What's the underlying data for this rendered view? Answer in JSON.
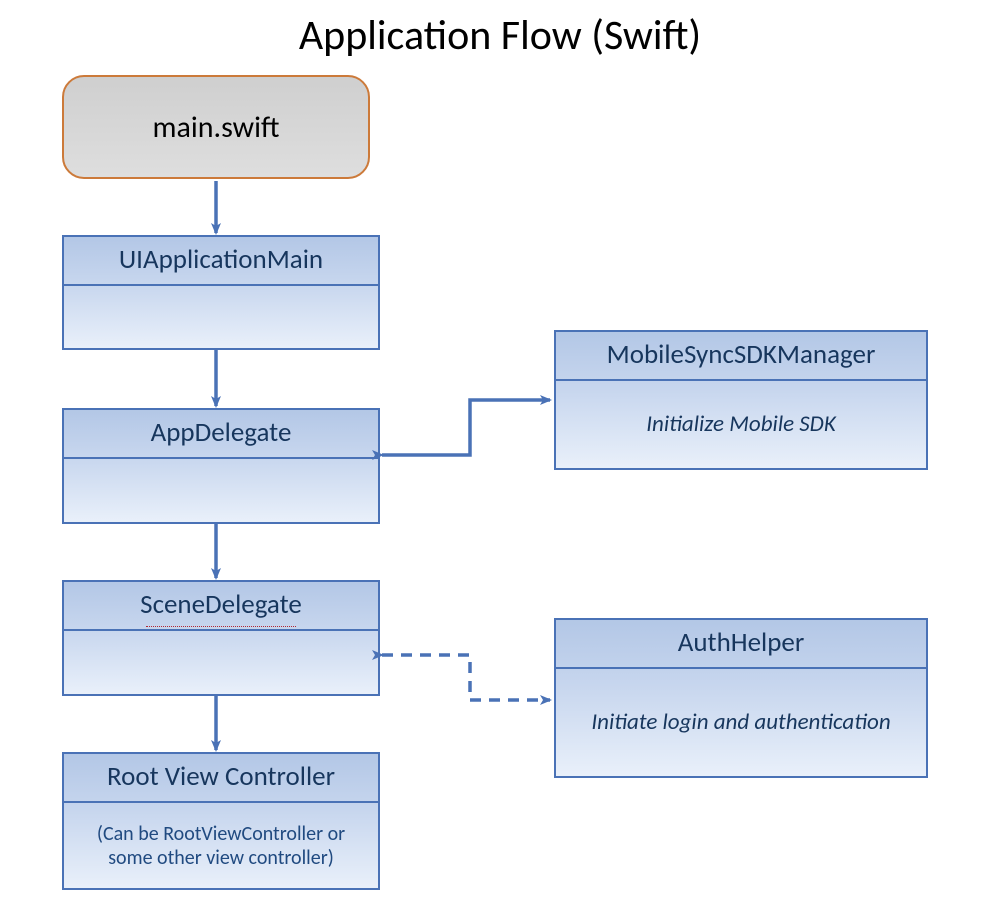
{
  "title": "Application Flow (Swift)",
  "nodes": {
    "main": {
      "label": "main.swift"
    },
    "uiapp": {
      "head": "UIApplicationMain",
      "body": ""
    },
    "appdelegate": {
      "head": "AppDelegate",
      "body": ""
    },
    "scenedelegate": {
      "head": "SceneDelegate",
      "body": ""
    },
    "rootvc": {
      "head": "Root View Controller",
      "body": "(Can be RootViewController or some other view controller)"
    },
    "sdkmanager": {
      "head": "MobileSyncSDKManager",
      "body": "Initialize Mobile SDK"
    },
    "authhelper": {
      "head": "AuthHelper",
      "body": "Initiate login and authentication"
    }
  },
  "colors": {
    "arrow": "#4a72b6"
  }
}
